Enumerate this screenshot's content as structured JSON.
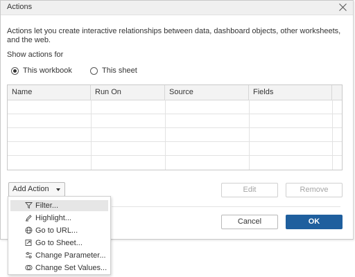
{
  "dialog": {
    "title": "Actions",
    "description": "Actions let you create interactive relationships between data, dashboard objects, other worksheets, and the web.",
    "show_actions_label": "Show actions for",
    "scope_options": [
      {
        "label": "This workbook",
        "checked": true
      },
      {
        "label": "This sheet",
        "checked": false
      }
    ]
  },
  "table": {
    "columns": [
      "Name",
      "Run On",
      "Source",
      "Fields"
    ],
    "rows": []
  },
  "buttons": {
    "add_action": "Add Action",
    "edit": "Edit",
    "remove": "Remove",
    "cancel": "Cancel",
    "ok": "OK"
  },
  "add_action_menu": {
    "items": [
      {
        "label": "Filter...",
        "icon": "filter-icon"
      },
      {
        "label": "Highlight...",
        "icon": "highlight-icon"
      },
      {
        "label": "Go to URL...",
        "icon": "globe-icon"
      },
      {
        "label": "Go to Sheet...",
        "icon": "go-to-sheet-icon"
      },
      {
        "label": "Change Parameter...",
        "icon": "parameter-icon"
      },
      {
        "label": "Change Set Values...",
        "icon": "set-values-icon"
      }
    ],
    "hovered_index": 0
  },
  "colors": {
    "primary_button": "#1f5f9e",
    "titlebar": "#f0f0f0",
    "menu_hover": "#e6e6e6"
  }
}
